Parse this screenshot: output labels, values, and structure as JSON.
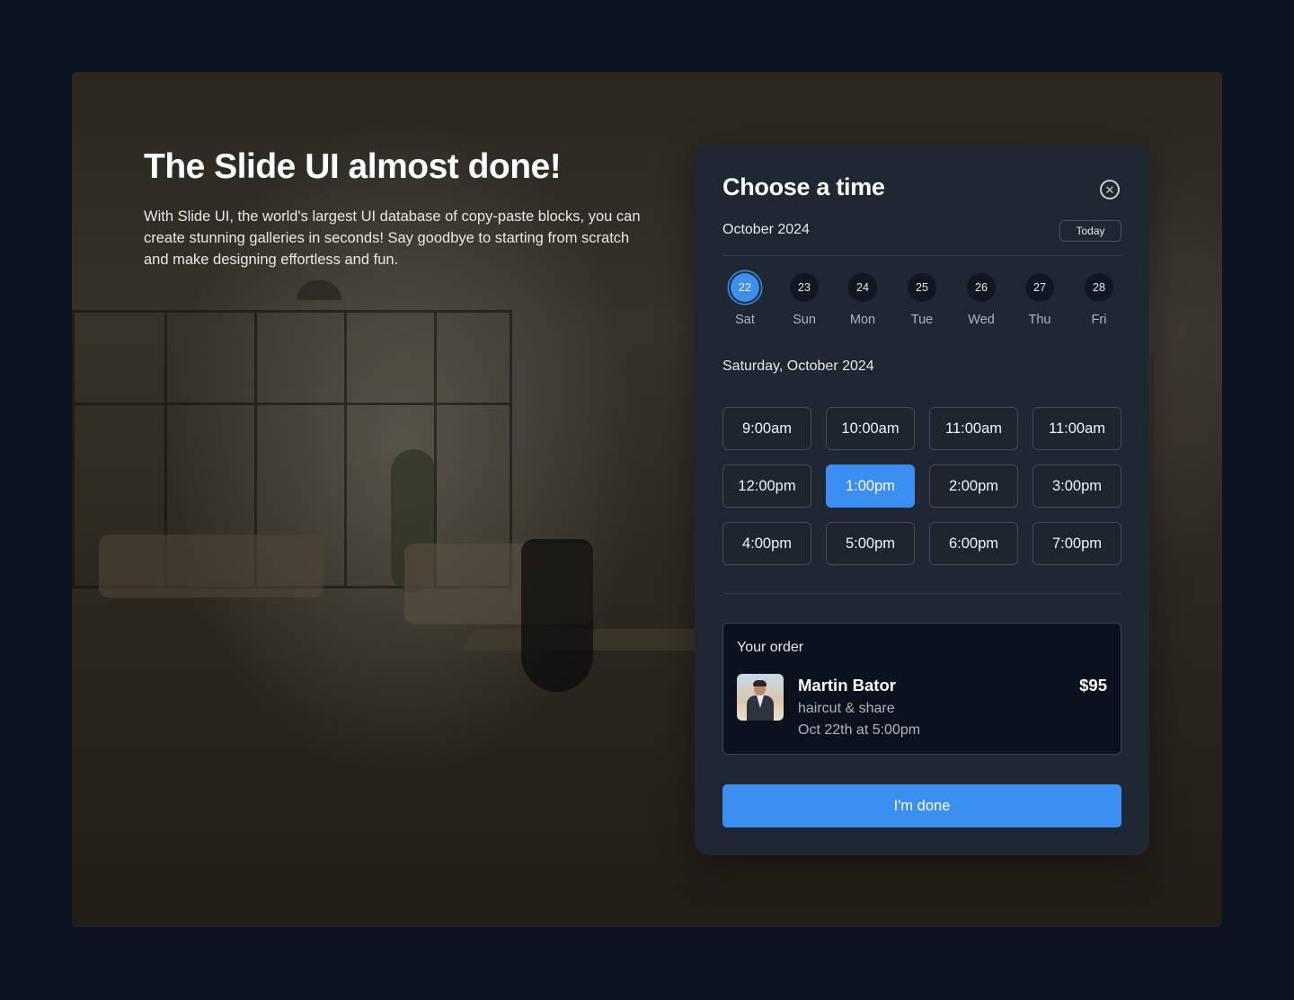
{
  "hero": {
    "title": "The Slide UI almost done!",
    "description": "With Slide UI, the world's largest UI database of copy-paste blocks, you can create stunning galleries in seconds! Say goodbye to starting from scratch and make designing effortless and fun."
  },
  "panel": {
    "title": "Choose a time",
    "close_icon": "close-circle-icon",
    "month": "October 2024",
    "today_label": "Today",
    "days": [
      {
        "num": "22",
        "label": "Sat",
        "active": true
      },
      {
        "num": "23",
        "label": "Sun",
        "active": false
      },
      {
        "num": "24",
        "label": "Mon",
        "active": false
      },
      {
        "num": "25",
        "label": "Tue",
        "active": false
      },
      {
        "num": "26",
        "label": "Wed",
        "active": false
      },
      {
        "num": "27",
        "label": "Thu",
        "active": false
      },
      {
        "num": "28",
        "label": "Fri",
        "active": false
      }
    ],
    "selected_date_heading": "Saturday, October 2024",
    "slots": [
      {
        "label": "9:00am",
        "selected": false
      },
      {
        "label": "10:00am",
        "selected": false
      },
      {
        "label": "11:00am",
        "selected": false
      },
      {
        "label": "11:00am",
        "selected": false
      },
      {
        "label": "12:00pm",
        "selected": false
      },
      {
        "label": "1:00pm",
        "selected": true
      },
      {
        "label": "2:00pm",
        "selected": false
      },
      {
        "label": "3:00pm",
        "selected": false
      },
      {
        "label": "4:00pm",
        "selected": false
      },
      {
        "label": "5:00pm",
        "selected": false
      },
      {
        "label": "6:00pm",
        "selected": false
      },
      {
        "label": "7:00pm",
        "selected": false
      }
    ],
    "order": {
      "label": "Your order",
      "name": "Martin Bator",
      "price": "$95",
      "service": "haircut & share",
      "when": "Oct 22th at 5:00pm"
    },
    "done_label": "I'm done"
  },
  "colors": {
    "page_bg": "#0c1322",
    "panel_bg": "#1f2733",
    "accent": "#3b8ff0",
    "order_bg": "#0c121d"
  }
}
